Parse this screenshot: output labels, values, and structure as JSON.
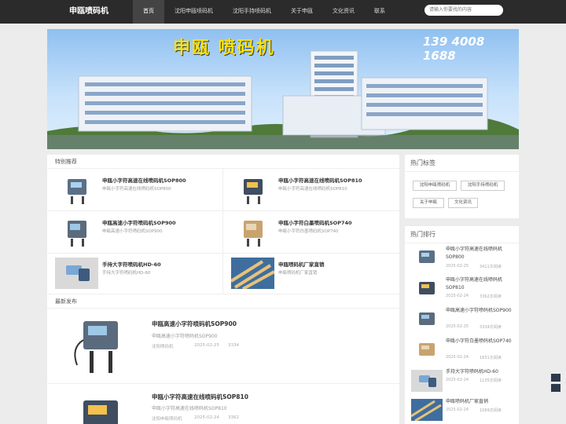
{
  "nav": {
    "logo": "申瓯喷码机",
    "items": [
      "首页",
      "沈阳申瓯喷码机",
      "沈阳手持喷码机",
      "关于申瓯",
      "文化资讯",
      "联系"
    ],
    "search_placeholder": "请输入你要找的内容"
  },
  "banner": {
    "title": "申瓯 喷码机",
    "phone": "139 4008 1688"
  },
  "featured": {
    "heading": "特别推荐",
    "items": [
      {
        "title": "申瓯小字符高速在线喷码机SOP800",
        "desc": "申瓯小字符高速在线喷码机SOP800"
      },
      {
        "title": "申瓯小字符高速在线喷码机SOP810",
        "desc": "申瓯小字符高速在线喷码机SOP810"
      },
      {
        "title": "申瓯高速小字符喷码机SOP900",
        "desc": "申瓯高速小字符喷码机SOP900"
      },
      {
        "title": "申瓯小字符白墨喷码机SOP740",
        "desc": "申瓯小字符白墨喷码机SOP740"
      },
      {
        "title": "手持大字符喷码机HD-60",
        "desc": "手持大字符喷码机HD-60"
      },
      {
        "title": "申瓯喷码机厂家直销",
        "desc": "申瓯喷码机厂家直销"
      }
    ]
  },
  "latest": {
    "heading": "最新发布",
    "posts": [
      {
        "title": "申瓯高速小字符喷码机SOP900",
        "desc": "申瓯高速小字符喷码机SOP900",
        "category": "沈阳喷码机",
        "date": "2025-02-25",
        "views": "3334"
      },
      {
        "title": "申瓯小字符高速在线喷码机SOP810",
        "desc": "申瓯小字符高速在线喷码机SOP810",
        "category": "沈阳申瓯喷码机",
        "date": "2025-02-24",
        "views": "3362"
      }
    ]
  },
  "tags": {
    "heading": "热门标签",
    "items": [
      "沈阳申瓯喷码机",
      "沈阳手持喷码机",
      "关于申瓯",
      "文化资讯"
    ]
  },
  "hot": {
    "heading": "热门排行",
    "items": [
      {
        "title": "申瓯小字符高速在线喷码机SOP800",
        "date": "2025-02-25",
        "reads": "3411次阅读"
      },
      {
        "title": "申瓯小字符高速在线喷码机SOP810",
        "date": "2025-02-24",
        "reads": "3362次阅读"
      },
      {
        "title": "申瓯高速小字符喷码机SOP900",
        "date": "2025-02-25",
        "reads": "3334次阅读"
      },
      {
        "title": "申瓯小字符白墨喷码机SOP740",
        "date": "2025-02-24",
        "reads": "1651次阅读"
      },
      {
        "title": "手持大字符喷码机HD-60",
        "date": "2025-02-24",
        "reads": "1135次阅读"
      },
      {
        "title": "申瓯喷码机厂家直销",
        "date": "2025-02-24",
        "reads": "1069次阅读"
      }
    ]
  }
}
